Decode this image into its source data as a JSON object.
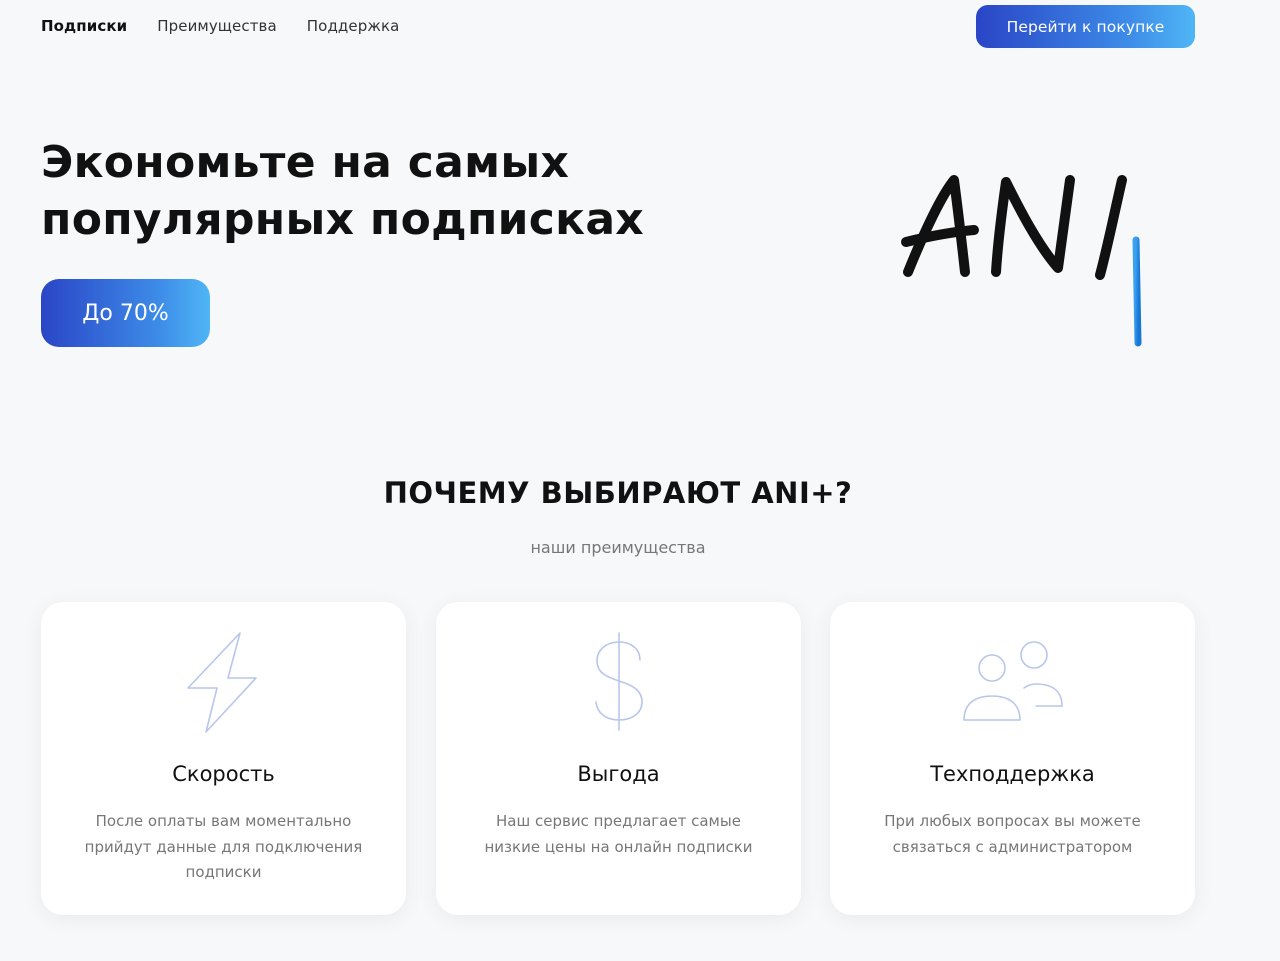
{
  "nav": {
    "items": [
      "Подписки",
      "Преимущества",
      "Поддержка"
    ],
    "cta_label": "Перейти к покупке"
  },
  "hero": {
    "title_line1": "Экономьте на самых",
    "title_line2": "популярных подписках",
    "badge_label": "До 70%"
  },
  "logo": {
    "text": "ANI",
    "plus": "+"
  },
  "section": {
    "title": "ПОЧЕМУ ВЫБИРАЮТ ANI+?",
    "subtitle": "наши преимущества"
  },
  "cards": [
    {
      "icon": "lightning-icon",
      "title": "Скорость",
      "text": "После оплаты вам моментально прийдут данные для подключения подписки"
    },
    {
      "icon": "dollar-icon",
      "title": "Выгода",
      "text": "Наш сервис предлагает самые низкие цены на онлайн подписки"
    },
    {
      "icon": "users-icon",
      "title": "Техподдержка",
      "text": "При любых вопросах вы можете связаться с администратором"
    }
  ],
  "colors": {
    "accent_start": "#2a45c6",
    "accent_end": "#4fb6f5",
    "icon_stroke": "#b9c6ec",
    "background": "#f7f8fa"
  }
}
